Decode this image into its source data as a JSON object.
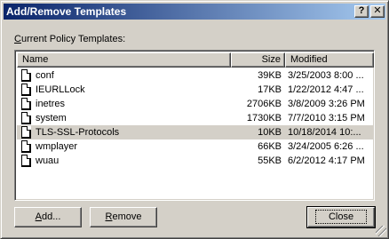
{
  "window": {
    "title": "Add/Remove Templates",
    "help_glyph": "?",
    "close_glyph": "✕"
  },
  "list": {
    "label_accel": "C",
    "label_rest": "urrent Policy Templates:",
    "columns": {
      "name": "Name",
      "size": "Size",
      "modified": "Modified"
    },
    "rows": [
      {
        "name": "conf",
        "size": "39KB",
        "modified": "3/25/2003 8:00 ..."
      },
      {
        "name": "IEURLLock",
        "size": "17KB",
        "modified": "1/22/2012 4:47 ..."
      },
      {
        "name": "inetres",
        "size": "2706KB",
        "modified": "3/8/2009 3:26 PM"
      },
      {
        "name": "system",
        "size": "1730KB",
        "modified": "7/7/2010 3:15 PM"
      },
      {
        "name": "TLS-SSL-Protocols",
        "size": "10KB",
        "modified": "10/18/2014 10:..."
      },
      {
        "name": "wmplayer",
        "size": "66KB",
        "modified": "3/24/2005 6:26 ..."
      },
      {
        "name": "wuau",
        "size": "55KB",
        "modified": "6/2/2012 4:17 PM"
      }
    ],
    "selected_row": "TLS-SSL-Protocols"
  },
  "buttons": {
    "add_accel": "A",
    "add_rest": "dd...",
    "remove_accel": "R",
    "remove_rest": "emove",
    "close": "Close"
  },
  "colors": {
    "title_start": "#0a246a",
    "title_end": "#a6caf0",
    "face": "#d4d0c8"
  }
}
